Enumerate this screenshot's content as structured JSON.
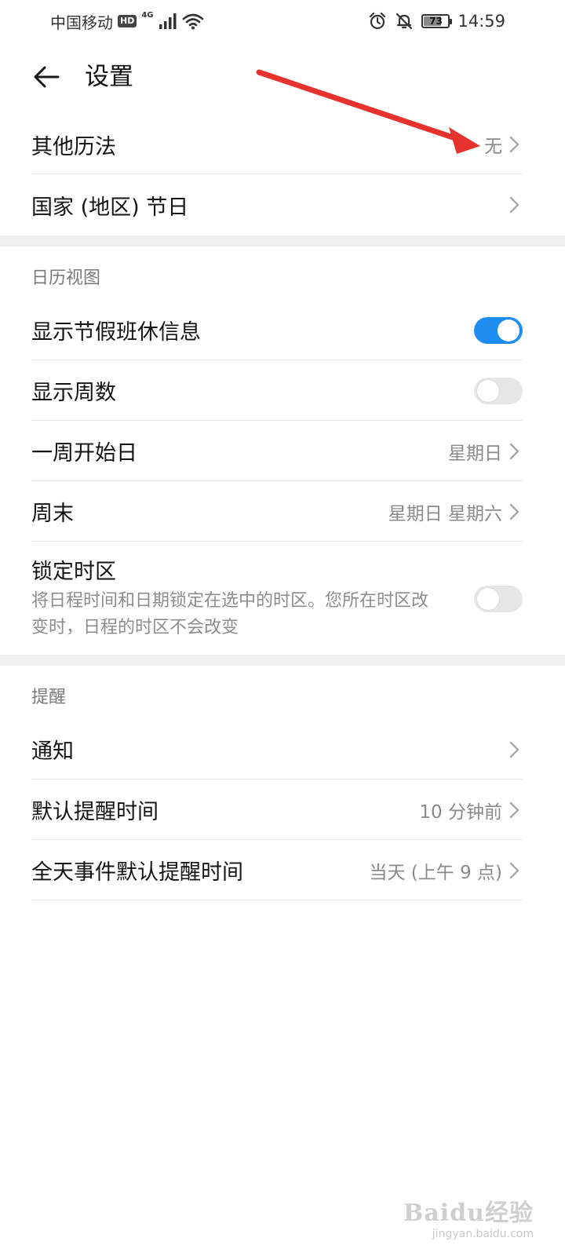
{
  "status_bar": {
    "carrier": "中国移动",
    "hd": "HD",
    "network": "4G",
    "battery": "73",
    "battery_level": 0.73,
    "time": "14:59"
  },
  "toolbar": {
    "title": "设置"
  },
  "general": {
    "other_calendar": {
      "label": "其他历法",
      "value": "无"
    },
    "holidays": {
      "label": "国家 (地区) 节日"
    }
  },
  "calendar_view": {
    "header": "日历视图",
    "show_holiday_info": {
      "label": "显示节假班休信息",
      "enabled": true
    },
    "show_week_number": {
      "label": "显示周数",
      "enabled": false
    },
    "week_start": {
      "label": "一周开始日",
      "value": "星期日"
    },
    "weekend": {
      "label": "周末",
      "value": "星期日 星期六"
    },
    "lock_timezone": {
      "label": "锁定时区",
      "description": "将日程时间和日期锁定在选中的时区。您所在时区改变时，日程的时区不会改变",
      "enabled": false
    }
  },
  "reminders": {
    "header": "提醒",
    "notifications": {
      "label": "通知"
    },
    "default_reminder": {
      "label": "默认提醒时间",
      "value": "10 分钟前"
    },
    "all_day_reminder": {
      "label": "全天事件默认提醒时间",
      "value": "当天 (上午 9 点)"
    }
  },
  "watermark": {
    "brand": "Baidu经验",
    "url": "jingyan.baidu.com"
  },
  "colors": {
    "accent": "#1d8df2",
    "annotation_arrow": "#e8322e",
    "divider": "#e6e6e6",
    "section_gap": "#efefef"
  }
}
